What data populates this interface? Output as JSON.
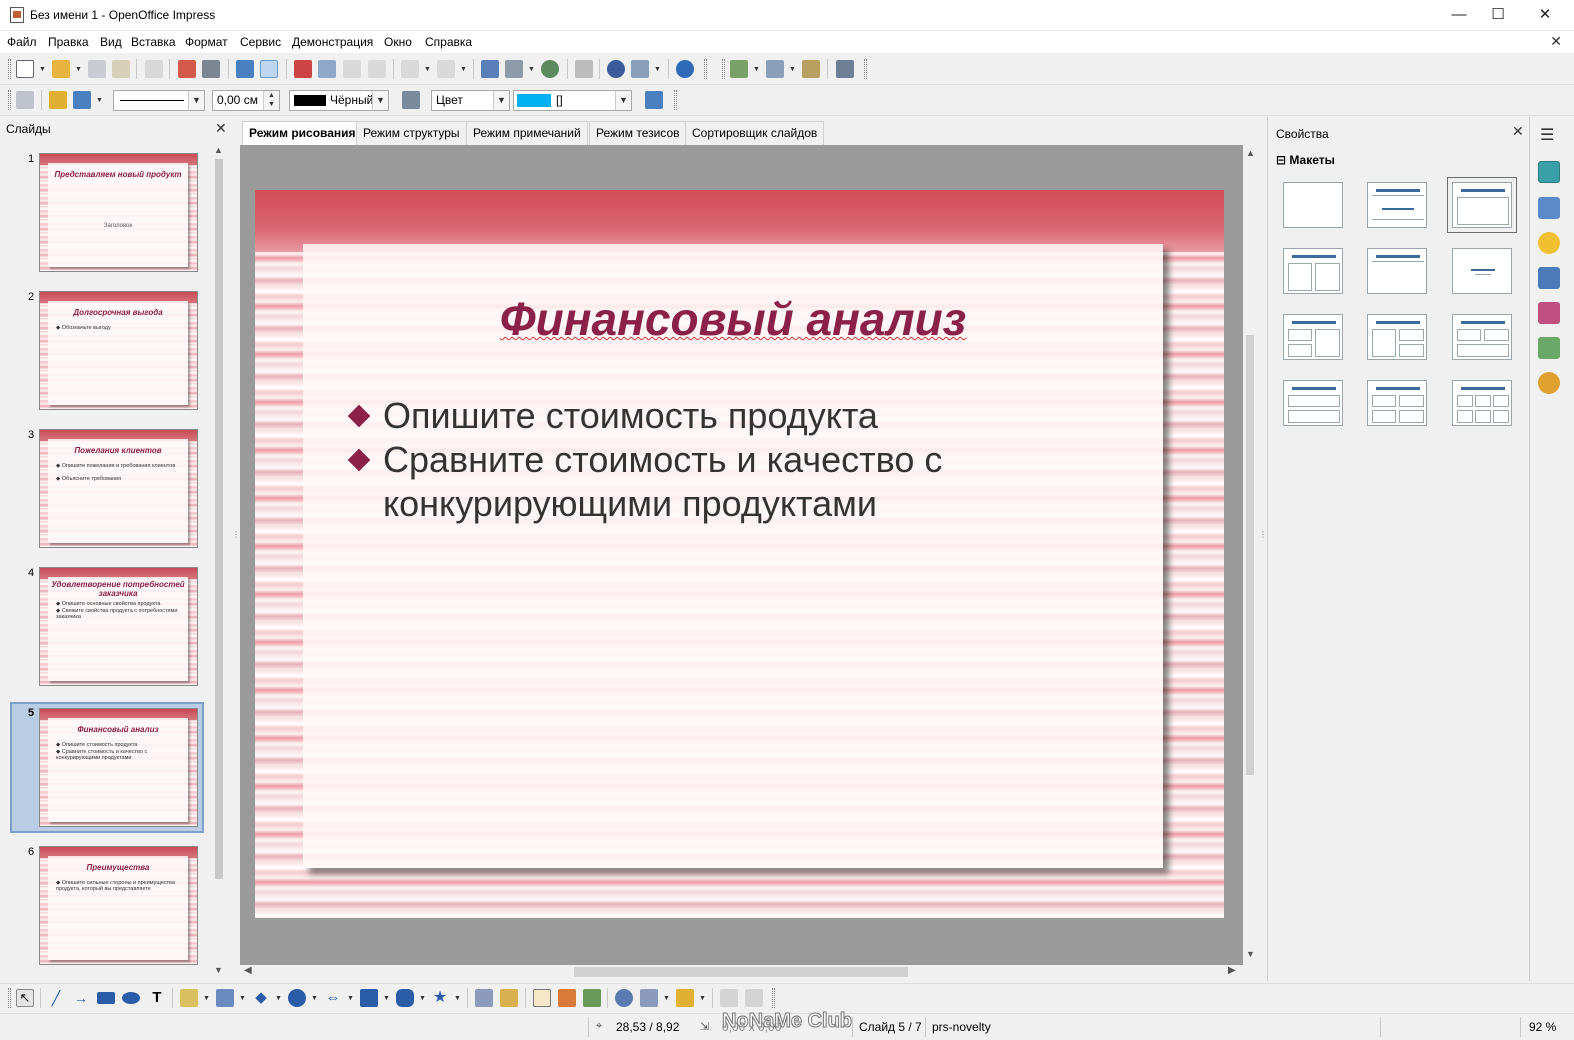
{
  "window": {
    "title": "Без имени 1 - OpenOffice Impress",
    "minimize": "—",
    "maximize": "☐",
    "close": "✕"
  },
  "menu": [
    "Файл",
    "Правка",
    "Вид",
    "Вставка",
    "Формат",
    "Сервис",
    "Демонстрация",
    "Окно",
    "Справка"
  ],
  "format_bar": {
    "line_width": "0,00 см",
    "line_color": "Чёрный",
    "area_style": "Цвет",
    "area_color": "[]"
  },
  "slides_panel": {
    "title": "Слайды",
    "close": "✕"
  },
  "slides": [
    {
      "num": "1",
      "title": "Представляем новый продукт",
      "subtitle": "Заголовок",
      "bullets": []
    },
    {
      "num": "2",
      "title": "Долгосрочная выгода",
      "bullets": [
        "Обозначьте выгоду"
      ]
    },
    {
      "num": "3",
      "title": "Пожелания клиентов",
      "bullets": [
        "Опишите пожелания и требования клиентов",
        "Объясните требования"
      ]
    },
    {
      "num": "4",
      "title": "Удовлетворение потребностей заказчика",
      "bullets": [
        "Опишите основные свойства продукта",
        "Свяжите свойства продукта с потребностями заказчика"
      ]
    },
    {
      "num": "5",
      "title": "Финансовый анализ",
      "bullets": [
        "Опишите стоимость продукта",
        "Сравните стоимость и качество с конкурирующими продуктами"
      ]
    },
    {
      "num": "6",
      "title": "Преимущества",
      "bullets": [
        "Опишите сильные стороны и преимущества продукта, который вы представляете"
      ]
    }
  ],
  "selected_slide_index": 4,
  "view_tabs": [
    "Режим рисования",
    "Режим структуры",
    "Режим примечаний",
    "Режим тезисов",
    "Сортировщик слайдов"
  ],
  "active_tab_index": 0,
  "current_slide": {
    "title": "Финансовый анализ",
    "bullets": [
      "Опишите стоимость продукта",
      "Сравните стоимость и качество с конкурирующими продуктами"
    ]
  },
  "properties": {
    "title": "Свойства",
    "close": "✕",
    "section": "Макеты",
    "collapse": "⊟"
  },
  "status": {
    "position": "28,53 / 8,92",
    "size": "0,00 x 0,00",
    "slide": "Слайд 5 / 7",
    "template": "prs-novelty",
    "zoom": "92 %",
    "watermark": "NoNaMe Club"
  },
  "colors": {
    "accent": "#8b2048",
    "header_band": "#d34d5a",
    "selection": "#b8cde4",
    "area_color": "#00b0f0"
  }
}
